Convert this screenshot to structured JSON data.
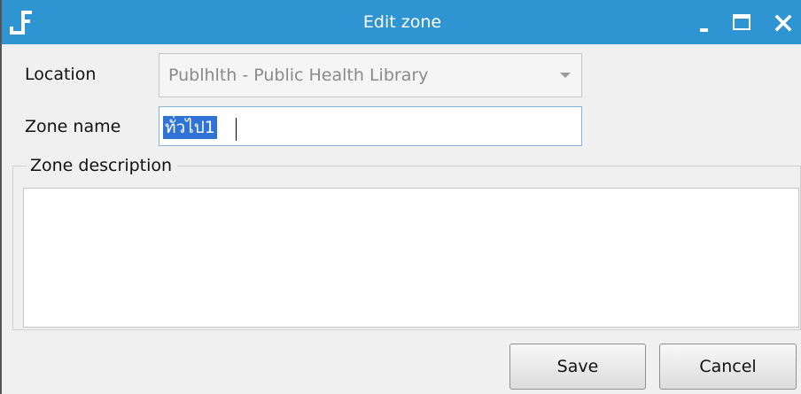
{
  "window": {
    "title": "Edit zone",
    "titlebar_color": "#2f94d2",
    "icons": [
      "app-icon",
      "minimize-icon",
      "maximize-icon",
      "close-icon"
    ]
  },
  "form": {
    "location_label": "Location",
    "location_value": "Publhlth - Public Health Library",
    "zone_name_label": "Zone name",
    "zone_name_value": "ทั่วไป1",
    "zone_description_label": "Zone description",
    "zone_description_value": ""
  },
  "buttons": {
    "save_label": "Save",
    "cancel_label": "Cancel"
  }
}
